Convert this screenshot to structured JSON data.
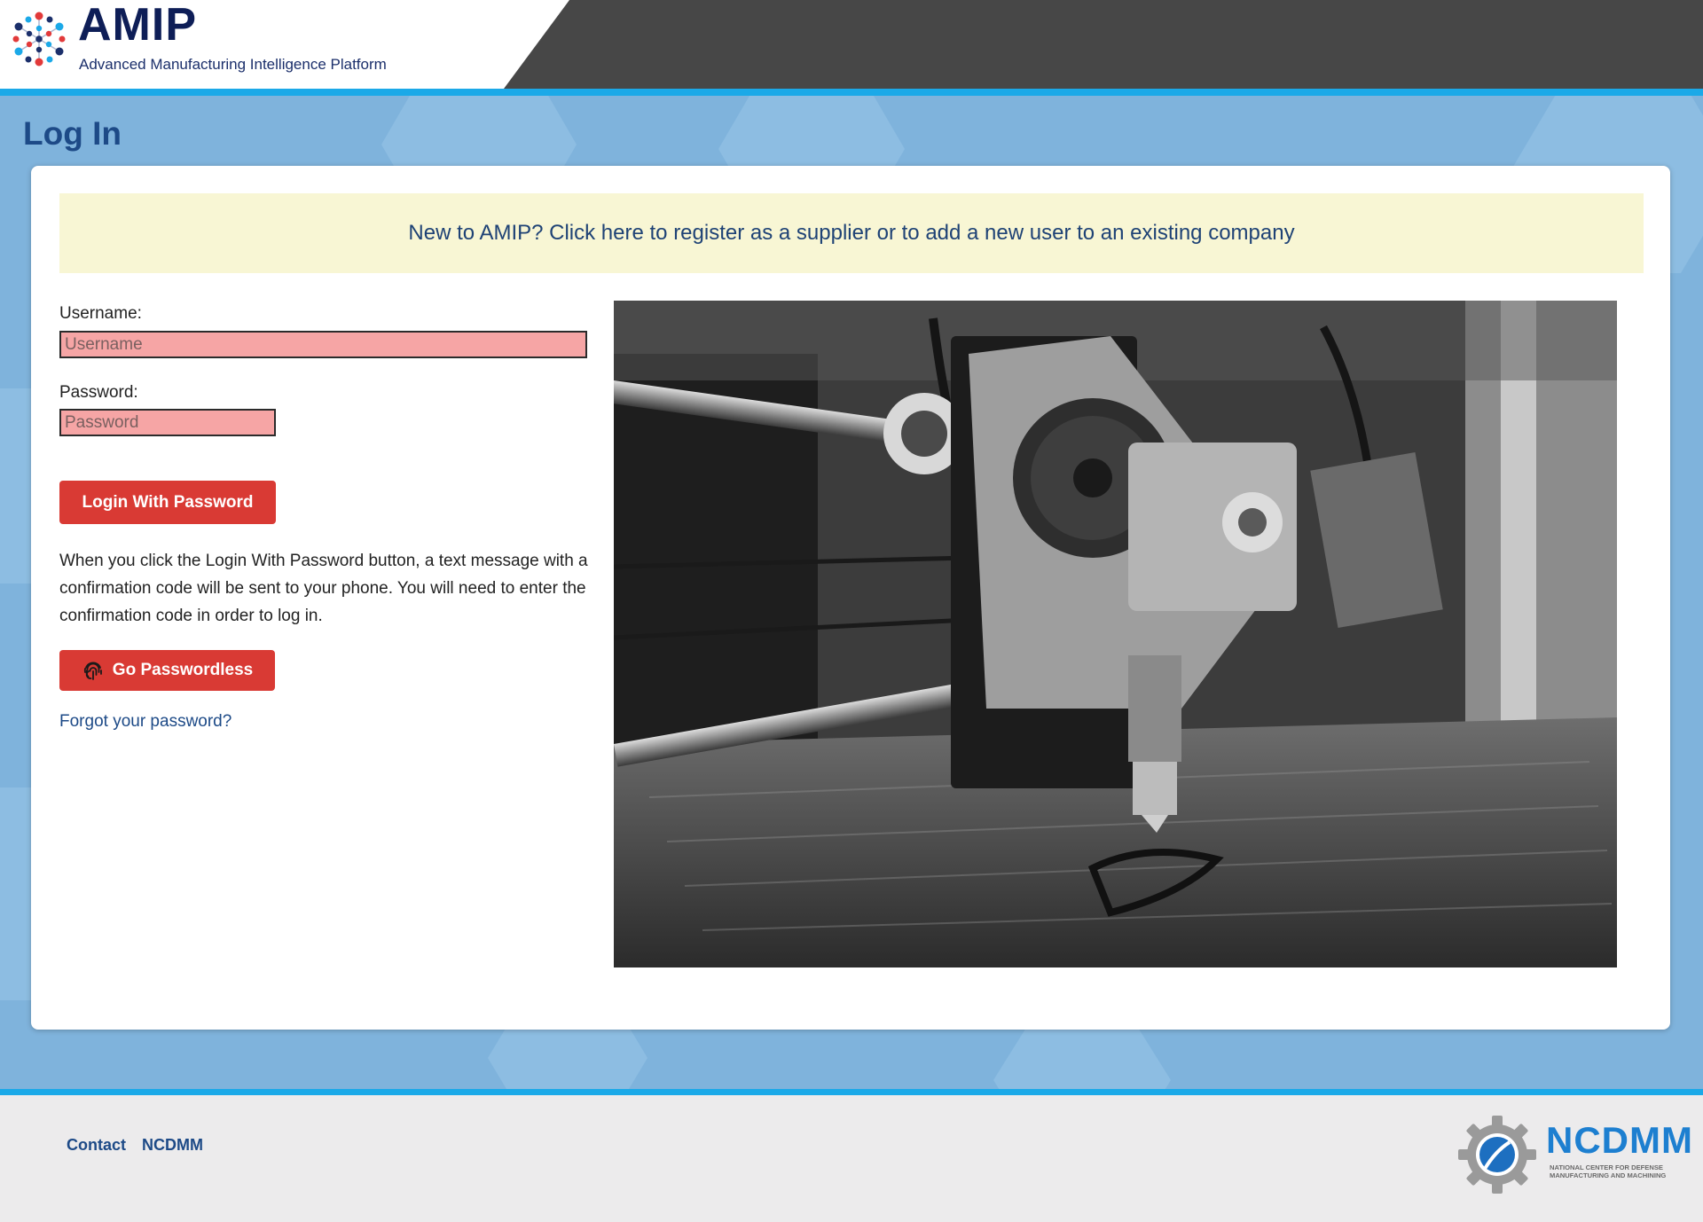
{
  "header": {
    "app_name": "AMIP",
    "app_tagline": "Advanced Manufacturing Intelligence Platform"
  },
  "page": {
    "title": "Log In"
  },
  "register_banner": {
    "text": "New to AMIP? Click here to register as a supplier or to add a new user to an existing company"
  },
  "login_form": {
    "username_label": "Username:",
    "username_placeholder": "Username",
    "username_value": "",
    "password_label": "Password:",
    "password_placeholder": "Password",
    "password_value": "",
    "login_button_label": "Login With Password",
    "info_text": "When you click the Login With Password button, a text message with a confirmation code will be sent to your phone. You will need to enter the confirmation code in order to log in.",
    "passwordless_button_label": "Go Passwordless",
    "passwordless_icon": "fingerprint-icon",
    "forgot_link": "Forgot your password?"
  },
  "hero_image": {
    "subject": "3d-printer-extruder-photo"
  },
  "footer": {
    "links": [
      "Contact",
      "NCDMM"
    ],
    "org_logo_word": "NCDMM",
    "org_logo_subtitle": "NATIONAL CENTER FOR DEFENSE MANUFACTURING AND MACHINING"
  },
  "colors": {
    "header_dark": "#474747",
    "accent_rule": "#1ba9e8",
    "main_background": "#7fb3dc",
    "banner_background": "#f8f6d4",
    "button_red": "#d93a34",
    "input_invalid": "#f6a5a5",
    "title_blue": "#1d4a87",
    "footer_background": "#ecebec"
  }
}
